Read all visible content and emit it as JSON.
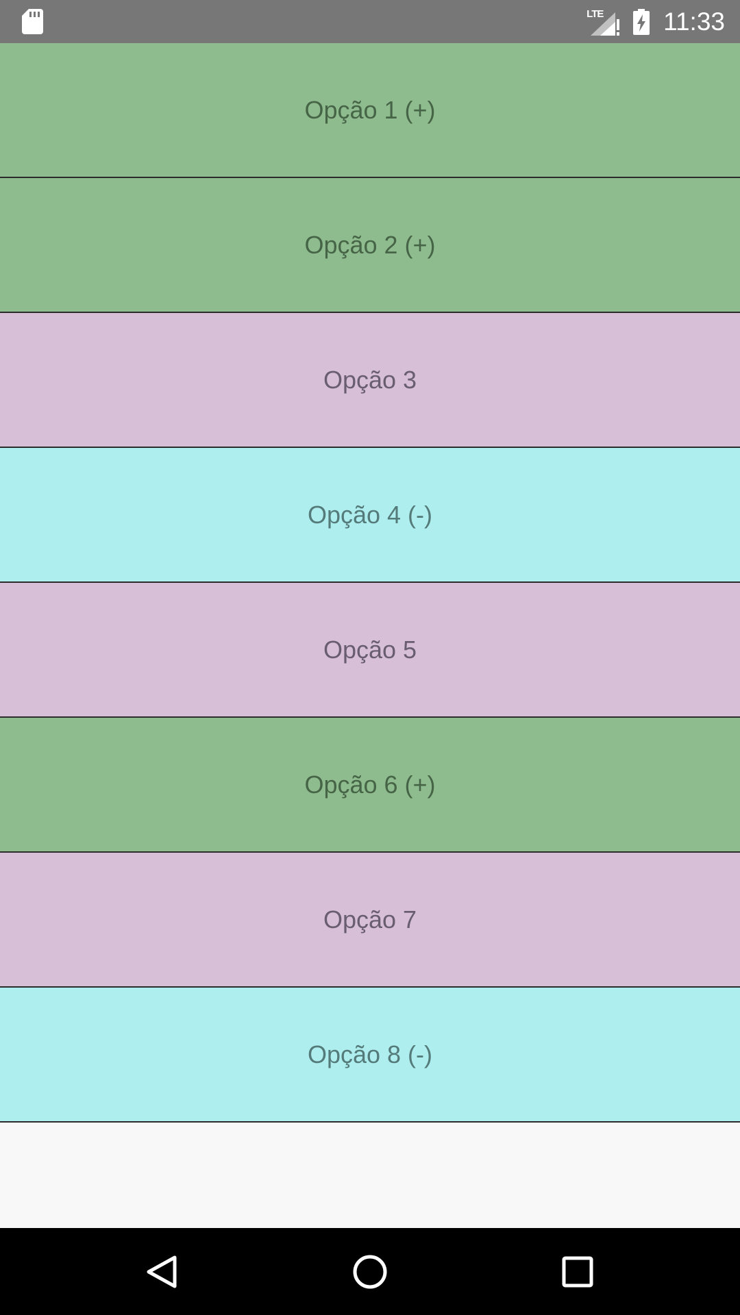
{
  "status_bar": {
    "network_label": "LTE",
    "time": "11:33",
    "icons": {
      "left": "sd-card-icon",
      "signal": "signal-no-data-icon",
      "battery": "battery-charging-icon"
    }
  },
  "list": {
    "items": [
      {
        "label": "Opção 1 (+)",
        "color": "#8fbc8f",
        "text_color": "#3f5b3f"
      },
      {
        "label": "Opção 2 (+)",
        "color": "#8fbc8f",
        "text_color": "#3f5b3f"
      },
      {
        "label": "Opção 3",
        "color": "#d8bfd8",
        "text_color": "#5e5464"
      },
      {
        "label": "Opção 4 (-)",
        "color": "#afeeee",
        "text_color": "#4c6e6e"
      },
      {
        "label": "Opção 5",
        "color": "#d8bfd8",
        "text_color": "#5e5464"
      },
      {
        "label": "Opção 6 (+)",
        "color": "#8fbc8f",
        "text_color": "#3f5b3f"
      },
      {
        "label": "Opção 7",
        "color": "#d8bfd8",
        "text_color": "#5e5464"
      },
      {
        "label": "Opção 8 (-)",
        "color": "#afeeee",
        "text_color": "#4c6e6e"
      }
    ]
  },
  "nav_bar": {
    "buttons": [
      "back-icon",
      "home-icon",
      "recents-icon"
    ]
  }
}
